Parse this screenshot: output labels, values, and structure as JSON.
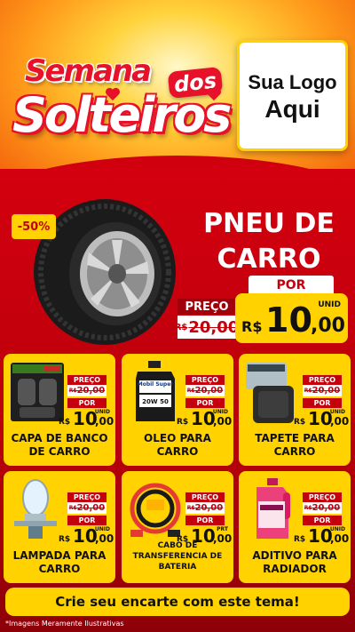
{
  "header": {
    "title_line1": "Semana",
    "title_badge": "dos",
    "title_line2": "Solteiros",
    "logo_line1": "Sua Logo",
    "logo_line2": "Aqui"
  },
  "hero": {
    "discount": "-50%",
    "name_line1": "PNEU DE",
    "name_line2": "CARRO",
    "por_label": "POR",
    "preco_label": "PREÇO",
    "old_currency": "R$",
    "old_price": "20,00",
    "currency": "R$",
    "price_int": "10",
    "price_dec": ",00",
    "unit": "UNID"
  },
  "products": [
    {
      "name": "CAPA DE BANCO DE CARRO",
      "preco_label": "PREÇO",
      "old_currency": "R$",
      "old_price": "20,00",
      "por_label": "POR",
      "currency": "R$",
      "price_int": "10",
      "price_dec": ",00",
      "unit": "UNID"
    },
    {
      "name": "OLEO PARA CARRO",
      "preco_label": "PREÇO",
      "old_currency": "R$",
      "old_price": "20,00",
      "por_label": "POR",
      "currency": "R$",
      "price_int": "10",
      "price_dec": ",00",
      "unit": "UNID"
    },
    {
      "name": "TAPETE PARA CARRO",
      "preco_label": "PREÇO",
      "old_currency": "R$",
      "old_price": "20,00",
      "por_label": "POR",
      "currency": "R$",
      "price_int": "10",
      "price_dec": ",00",
      "unit": "UNID"
    },
    {
      "name": "LAMPADA PARA CARRO",
      "preco_label": "PREÇO",
      "old_currency": "R$",
      "old_price": "20,00",
      "por_label": "POR",
      "currency": "R$",
      "price_int": "10",
      "price_dec": ",00",
      "unit": "UNID"
    },
    {
      "name": "CABO DE TRANSFERENCIA DE BATERIA",
      "preco_label": "PREÇO",
      "old_currency": "R$",
      "old_price": "20,00",
      "por_label": "POR",
      "currency": "R$",
      "price_int": "10",
      "price_dec": ",00",
      "unit": "PRT"
    },
    {
      "name": "ADITIVO PARA RADIADOR",
      "preco_label": "PREÇO",
      "old_currency": "R$",
      "old_price": "20,00",
      "por_label": "POR",
      "currency": "R$",
      "price_int": "10",
      "price_dec": ",00",
      "unit": "UNID"
    }
  ],
  "product_labels": {
    "oil_brand": "Mobil Super",
    "oil_grade": "20W 50"
  },
  "cta": "Crie seu encarte com este tema!",
  "disclaimer": "*Imagens Meramente Ilustrativas",
  "colors": {
    "accent_yellow": "#ffd200",
    "brand_red": "#c4000c",
    "background_red": "#d4000f"
  }
}
